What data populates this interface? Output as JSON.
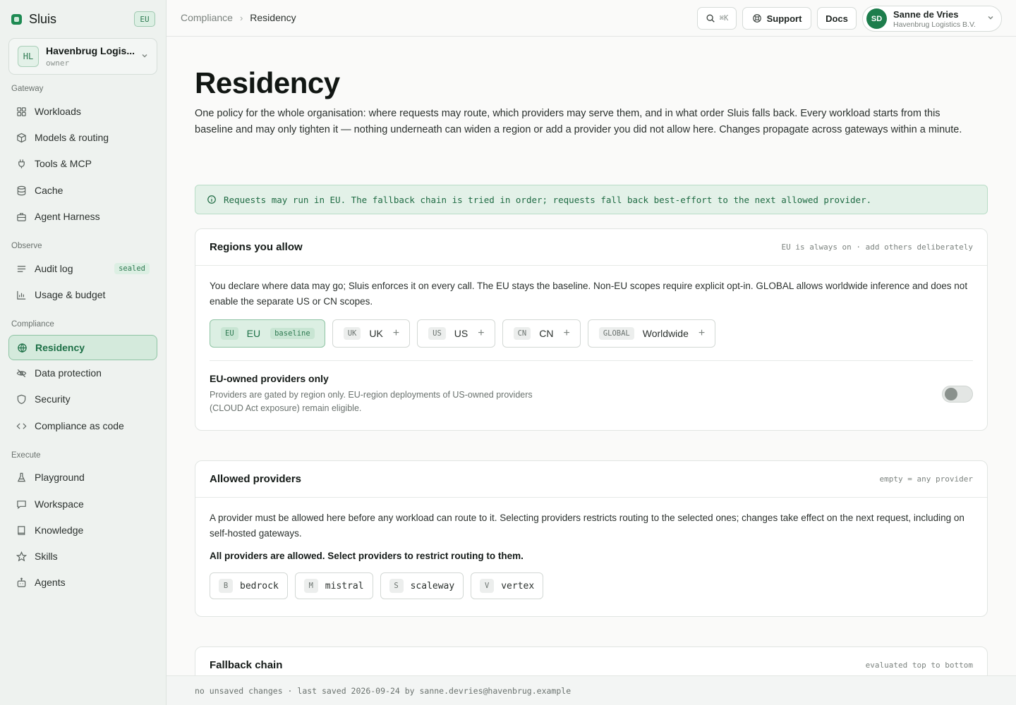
{
  "brand": {
    "name": "Sluis",
    "badge": "EU"
  },
  "org": {
    "initials": "HL",
    "name": "Havenbrug Logis...",
    "role": "owner"
  },
  "nav": {
    "gateway_label": "Gateway",
    "gateway": [
      {
        "label": "Workloads",
        "icon": "grid-icon"
      },
      {
        "label": "Models & routing",
        "icon": "cube-icon"
      },
      {
        "label": "Tools & MCP",
        "icon": "plug-icon"
      },
      {
        "label": "Cache",
        "icon": "database-icon"
      },
      {
        "label": "Agent Harness",
        "icon": "briefcase-icon"
      }
    ],
    "observe_label": "Observe",
    "observe": [
      {
        "label": "Audit log",
        "icon": "list-icon",
        "badge": "sealed"
      },
      {
        "label": "Usage & budget",
        "icon": "bar-chart-icon"
      }
    ],
    "compliance_label": "Compliance",
    "compliance": [
      {
        "label": "Residency",
        "icon": "globe-icon",
        "active": true
      },
      {
        "label": "Data protection",
        "icon": "eye-off-icon"
      },
      {
        "label": "Security",
        "icon": "shield-icon"
      },
      {
        "label": "Compliance as code",
        "icon": "code-icon"
      }
    ],
    "execute_label": "Execute",
    "execute": [
      {
        "label": "Playground",
        "icon": "flask-icon"
      },
      {
        "label": "Workspace",
        "icon": "chat-icon"
      },
      {
        "label": "Knowledge",
        "icon": "book-icon"
      },
      {
        "label": "Skills",
        "icon": "star-icon"
      },
      {
        "label": "Agents",
        "icon": "robot-icon"
      }
    ]
  },
  "topbar": {
    "breadcrumb": [
      "Compliance",
      "Residency"
    ],
    "search_shortcut": "⌘K",
    "support_label": "Support",
    "docs_label": "Docs",
    "user": {
      "initials": "SD",
      "name": "Sanne de Vries",
      "org": "Havenbrug Logistics B.V."
    }
  },
  "page": {
    "title": "Residency",
    "description": "One policy for the whole organisation: where requests may route, which providers may serve them, and in what order Sluis falls back. Every workload starts from this baseline and may only tighten it — nothing underneath can widen a region or add a provider you did not allow here. Changes propagate across gateways within a minute.",
    "notice": "Requests may run in EU. The fallback chain is tried in order; requests fall back best-effort to the next allowed provider."
  },
  "regions": {
    "title": "Regions you allow",
    "meta": "EU is always on · add others deliberately",
    "description": "You declare where data may go; Sluis enforces it on every call. The EU stays the baseline. Non-EU scopes require explicit opt-in. GLOBAL allows worldwide inference and does not enable the separate US or CN scopes.",
    "items": [
      {
        "code": "EU",
        "label": "EU",
        "tag": "baseline",
        "enabled": true
      },
      {
        "code": "UK",
        "label": "UK",
        "enabled": false
      },
      {
        "code": "US",
        "label": "US",
        "enabled": false
      },
      {
        "code": "CN",
        "label": "CN",
        "enabled": false
      },
      {
        "code": "GLOBAL",
        "label": "Worldwide",
        "enabled": false
      }
    ],
    "eu_owned": {
      "title": "EU-owned providers only",
      "description": "Providers are gated by region only. EU-region deployments of US-owned providers (CLOUD Act exposure) remain eligible.",
      "enabled": false
    }
  },
  "providers": {
    "title": "Allowed providers",
    "meta": "empty = any provider",
    "description": "A provider must be allowed here before any workload can route to it. Selecting providers restricts routing to the selected ones; changes take effect on the next request, including on self-hosted gateways.",
    "status": "All providers are allowed. Select providers to restrict routing to them.",
    "items": [
      {
        "letter": "B",
        "name": "bedrock"
      },
      {
        "letter": "M",
        "name": "mistral"
      },
      {
        "letter": "S",
        "name": "scaleway"
      },
      {
        "letter": "V",
        "name": "vertex"
      }
    ]
  },
  "fallback": {
    "title": "Fallback chain",
    "meta": "evaluated top to bottom"
  },
  "footer": {
    "status": "no unsaved changes · last saved 2026-09-24 by sanne.devries@havenbrug.example"
  },
  "colors": {
    "accent": "#1d8a52",
    "accent_bg": "#dcefe3",
    "accent_border": "#8fc4a4"
  }
}
